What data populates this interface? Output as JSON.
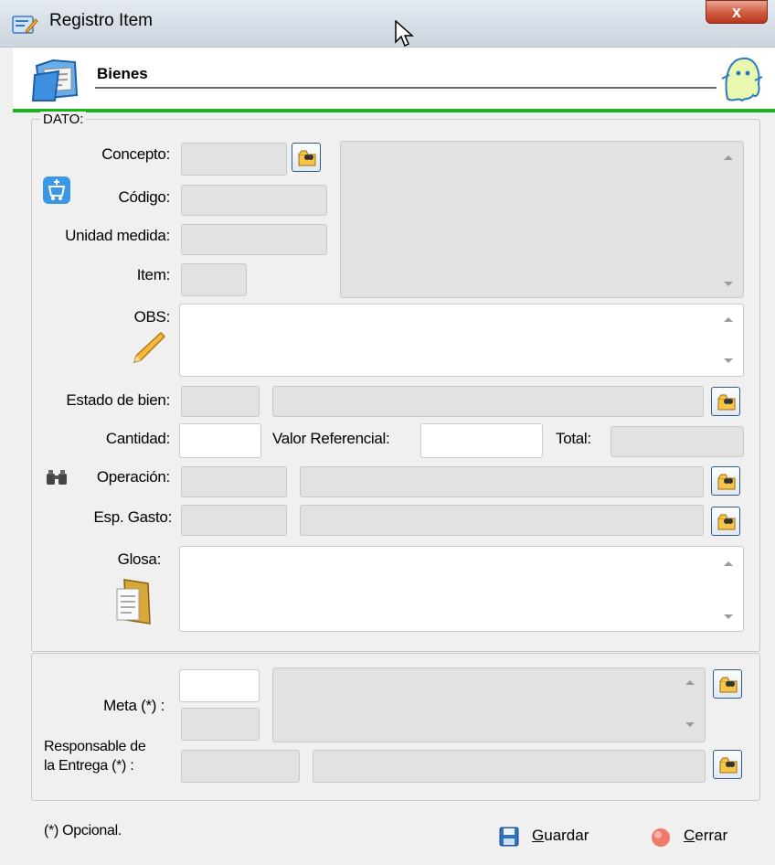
{
  "window": {
    "title": "Registro Item",
    "close_glyph": "x",
    "app_icon": "edit-form-icon"
  },
  "header": {
    "title": "Bienes",
    "left_icon": "folder-document-icon",
    "right_icon": "ghost-icon",
    "accent_color": "#18b418"
  },
  "group": {
    "label": "DATO:"
  },
  "labels": {
    "concepto": "Concepto:",
    "codigo": "Código:",
    "unidad_medida": "Unidad medida:",
    "item": "Item:",
    "obs": "OBS:",
    "estado_bien": "Estado de bien:",
    "cantidad": "Cantidad:",
    "valor_referencial": "Valor Referencial:",
    "total": "Total:",
    "operacion": "Operación:",
    "esp_gasto": "Esp. Gasto:",
    "glosa": "Glosa:",
    "meta": "Meta (*) :",
    "responsable_line1": "Responsable de",
    "responsable_line2": "la Entrega (*) :"
  },
  "fields": {
    "concepto": "",
    "codigo": "",
    "unidad_medida": "",
    "item": "",
    "concepto_desc": "",
    "obs": "",
    "estado_code": "",
    "estado_desc": "",
    "cantidad": "",
    "valor_referencial": "",
    "total": "",
    "operacion_code": "",
    "operacion_desc": "",
    "esp_gasto_code": "",
    "esp_gasto_desc": "",
    "glosa": "",
    "meta_code": "",
    "meta_code2": "",
    "meta_desc": "",
    "responsable_code": "",
    "responsable_desc": ""
  },
  "footer": {
    "note": "(*) Opcional.",
    "save_accel": "G",
    "save_rest": "uardar",
    "close_accel": "C",
    "close_rest": "errar",
    "save_icon": "floppy-disk-icon",
    "close_icon": "red-circle-icon"
  }
}
